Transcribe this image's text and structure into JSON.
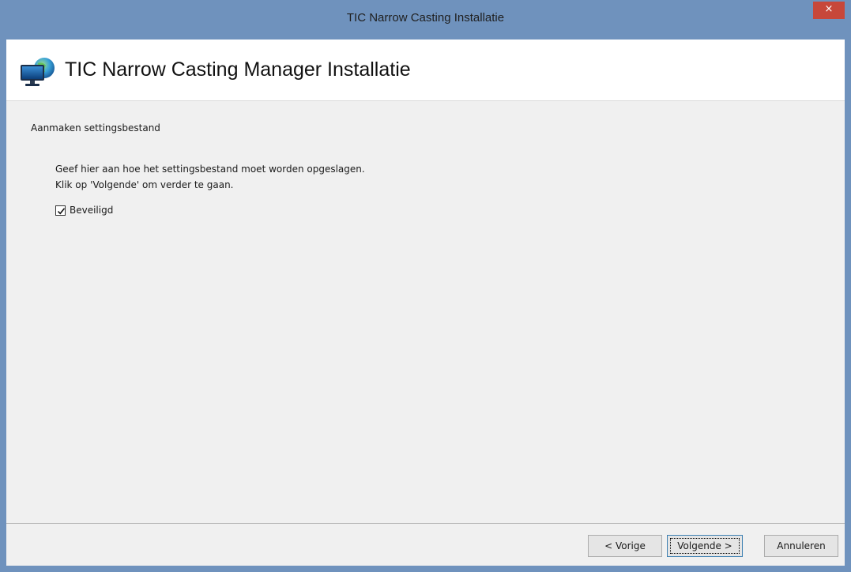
{
  "window": {
    "title": "TIC Narrow Casting Installatie",
    "close_glyph": "×"
  },
  "header": {
    "icon": "monitor-globe-icon",
    "title": "TIC Narrow Casting Manager Installatie"
  },
  "content": {
    "section_title": "Aanmaken settingsbestand",
    "description_line1": "Geef hier aan hoe het settingsbestand moet worden opgeslagen.",
    "description_line2": "Klik op 'Volgende' om verder te gaan.",
    "checkbox": {
      "label": "Beveiligd",
      "checked": true
    }
  },
  "footer": {
    "prev_label": "< Vorige",
    "next_label": "Volgende >",
    "cancel_label": "Annuleren"
  },
  "colors": {
    "titlebar": "#6f92bd",
    "close_button": "#c7473a",
    "client_bg": "#f0f0f0",
    "header_bg": "#ffffff"
  }
}
